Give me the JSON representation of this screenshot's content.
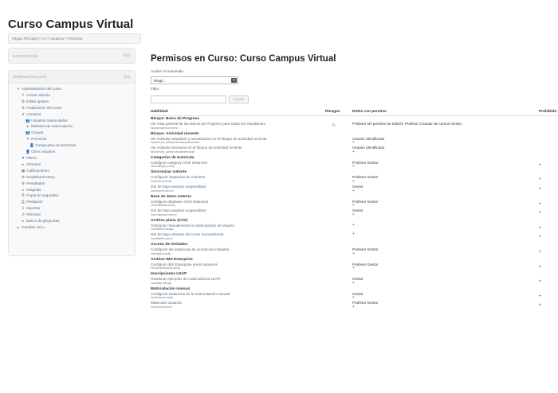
{
  "site_title": "Curso Campus Virtual",
  "breadcrumb": "Página Principal  >  CV  >  Usuarios  >  Permisos",
  "nav_block": {
    "title": "NAVEGACIÓN",
    "controls": "⊟⊡"
  },
  "admin_block": {
    "title": "ADMINISTRACIÓN",
    "controls": "⊟⊡",
    "items": [
      {
        "label": "Administración del curso",
        "icon": "▾",
        "level": 1
      },
      {
        "label": "Activar edición",
        "icon": "✎",
        "level": 2
      },
      {
        "label": "Editar ajustes",
        "icon": "⚙",
        "level": 2
      },
      {
        "label": "Finalización del curso",
        "icon": "⚙",
        "level": 2
      },
      {
        "label": "Usuarios",
        "icon": "▾",
        "level": 2
      },
      {
        "label": "Usuarios matriculados",
        "icon": "👥",
        "level": 3
      },
      {
        "label": "Métodos de matriculación",
        "icon": "▸",
        "level": 3
      },
      {
        "label": "Grupos",
        "icon": "👥",
        "level": 3
      },
      {
        "label": "Permisos",
        "icon": "▾",
        "level": 3
      },
      {
        "label": "Comprueba los permisos",
        "icon": "👤",
        "level": 4
      },
      {
        "label": "Otros usuarios",
        "icon": "👤",
        "level": 3
      },
      {
        "label": "Filtros",
        "icon": "▼",
        "level": 2
      },
      {
        "label": "Informes",
        "icon": "▸",
        "level": 2
      },
      {
        "label": "Calificaciones",
        "icon": "▦",
        "level": 2
      },
      {
        "label": "Gradebook setup",
        "icon": "⚙",
        "level": 2
      },
      {
        "label": "Resultados",
        "icon": "⚙",
        "level": 2
      },
      {
        "label": "Insignias",
        "icon": "▸",
        "level": 2
      },
      {
        "label": "Copia de seguridad",
        "icon": "⎘",
        "level": 2
      },
      {
        "label": "Restaurar",
        "icon": "⎙",
        "level": 2
      },
      {
        "label": "Importar",
        "icon": "⇩",
        "level": 2
      },
      {
        "label": "Reiniciar",
        "icon": "↺",
        "level": 2
      },
      {
        "label": "Banco de preguntas",
        "icon": "▸",
        "level": 2
      },
      {
        "label": "Cambiar rol a...",
        "icon": "▸",
        "level": 1
      }
    ]
  },
  "main": {
    "heading": "Permisos en Curso: Curso Campus Virtual",
    "override_label": "Anular rol avanzado",
    "select_value": "Elegir...",
    "filter_label": "Filtro",
    "filter_button": "Limpiar",
    "columns": [
      "Habilidad",
      "Riesgos",
      "Roles con permiso",
      "Prohibido"
    ],
    "rows": [
      {
        "type": "group",
        "label": "Bloque: Barra de Progreso"
      },
      {
        "type": "cap",
        "name": "Ver vista general de las Barras de Progreso para todos los estudiantes",
        "code": "block/progress:overview",
        "risk": "⚠",
        "roles": "Profesor sin permiso de edición   Profesor   Creador de cursos   Gestor",
        "plus": false,
        "prohib": ""
      },
      {
        "type": "group",
        "label": "Bloque: Actividad reciente"
      },
      {
        "type": "cap",
        "name": "Ver módulos añadidos y actualizados en el bloque de actividad reciente",
        "code": "block/recent_activity:viewaddupdatemodule",
        "risk": "",
        "roles": "Usuario identificado",
        "plus": true,
        "prohib": ""
      },
      {
        "type": "cap",
        "name": "Ver módulos borrados en el bloque de actividad reciente",
        "code": "block/recent_activity:viewdeletemodule",
        "risk": "",
        "roles": "Usuario identificado",
        "plus": true,
        "prohib": ""
      },
      {
        "type": "group",
        "label": "Categorías de matrícula"
      },
      {
        "type": "cap",
        "name": "Configure category enrol instances",
        "code": "enrol/category:config",
        "risk": "",
        "roles": "Profesor   Gestor",
        "plus": true,
        "prohib": "+"
      },
      {
        "type": "group",
        "label": "Sincronizar cohorte"
      },
      {
        "type": "cap",
        "name": "Configurar instancias de cohortes",
        "code": "enrol/cohort:config",
        "risk": "",
        "roles": "Profesor   Gestor",
        "plus": true,
        "prohib": "+"
      },
      {
        "type": "cap",
        "name": "Dar de baja usuarios suspendidos",
        "code": "enrol/cohort:unenrol",
        "risk": "",
        "roles": "Gestor",
        "plus": true,
        "prohib": "+"
      },
      {
        "type": "group",
        "label": "Base de datos externa"
      },
      {
        "type": "cap",
        "name": "Configure database enrol instances",
        "code": "enrol/database:config",
        "risk": "",
        "roles": "Profesor   Gestor",
        "plus": true,
        "prohib": "+"
      },
      {
        "type": "cap",
        "name": "Dar de baja usuarios suspendidos",
        "code": "enrol/database:unenrol",
        "risk": "",
        "roles": "Gestor",
        "plus": true,
        "prohib": "+"
      },
      {
        "type": "group",
        "label": "Archivo plano (CSV)"
      },
      {
        "type": "cap",
        "name": "Gestionar manualmente la matriculación de usuario",
        "code": "enrol/flatfile:manage",
        "risk": "",
        "roles": "",
        "plus": true,
        "prohib": "+"
      },
      {
        "type": "cap",
        "name": "Dar de baja usuarios del curso manualmente",
        "code": "enrol/flatfile:unenrol",
        "risk": "",
        "roles": "",
        "plus": true,
        "prohib": "+"
      },
      {
        "type": "group",
        "label": "Acceso de invitados"
      },
      {
        "type": "cap",
        "name": "Configurar las instancias de acceso de invitados",
        "code": "enrol/guest:config",
        "risk": "",
        "roles": "Profesor   Gestor",
        "plus": true,
        "prohib": "+"
      },
      {
        "type": "group",
        "label": "Archivo IMS Enterprise"
      },
      {
        "type": "cap",
        "name": "Configure IMS Enterprise enrol instances",
        "code": "enrol/imsenterprise:config",
        "risk": "",
        "roles": "Profesor   Gestor",
        "plus": true,
        "prohib": "+"
      },
      {
        "type": "group",
        "label": "Inscripciones LDAP"
      },
      {
        "type": "cap",
        "name": "Gestionar ejemplos de matriculación LDAP",
        "code": "enrol/ldap:manage",
        "risk": "",
        "roles": "Gestor",
        "plus": true,
        "prohib": "+"
      },
      {
        "type": "group",
        "label": "Matriculación manual"
      },
      {
        "type": "cap",
        "name": "Configurar instancias de la matriculación manual",
        "code": "enrol/manual:config",
        "risk": "",
        "roles": "Gestor",
        "plus": true,
        "prohib": "+"
      },
      {
        "type": "cap",
        "name": "Matricular usuarios",
        "code": "enrol/manual:enrol",
        "risk": "",
        "roles": "Profesor   Gestor",
        "plus": true,
        "prohib": "+"
      }
    ]
  }
}
